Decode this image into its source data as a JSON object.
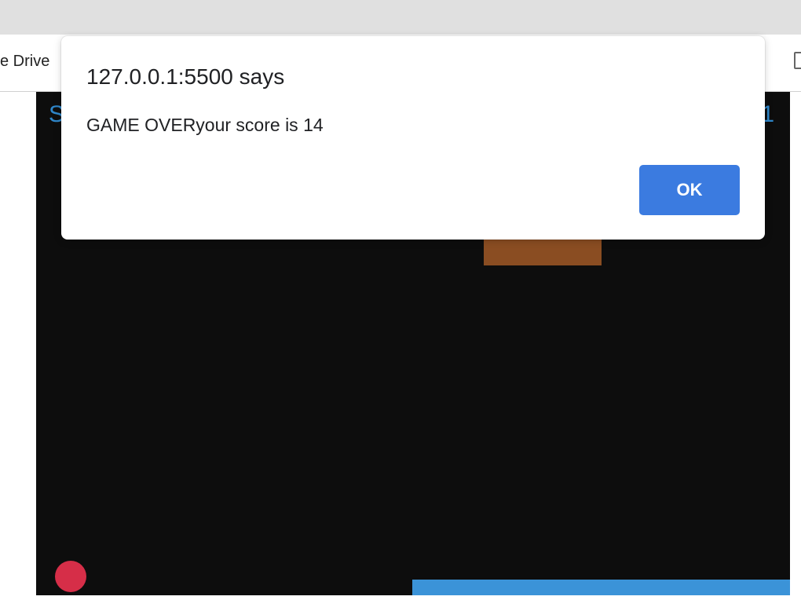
{
  "browser": {
    "bookmark_fragment": "e Drive",
    "icons": [
      "calendar-icon",
      "window-icon"
    ]
  },
  "game": {
    "score_fragment": "S",
    "lives_fragment": "1",
    "colors": {
      "background": "#0d0d0d",
      "block": "#8a4d22",
      "ball": "#d62e48",
      "paddle": "#3b93d8",
      "hud_text": "#2f86c9"
    }
  },
  "dialog": {
    "title": "127.0.0.1:5500 says",
    "message": "GAME OVERyour score is 14",
    "ok_label": "OK",
    "accent": "#3b7be0"
  }
}
